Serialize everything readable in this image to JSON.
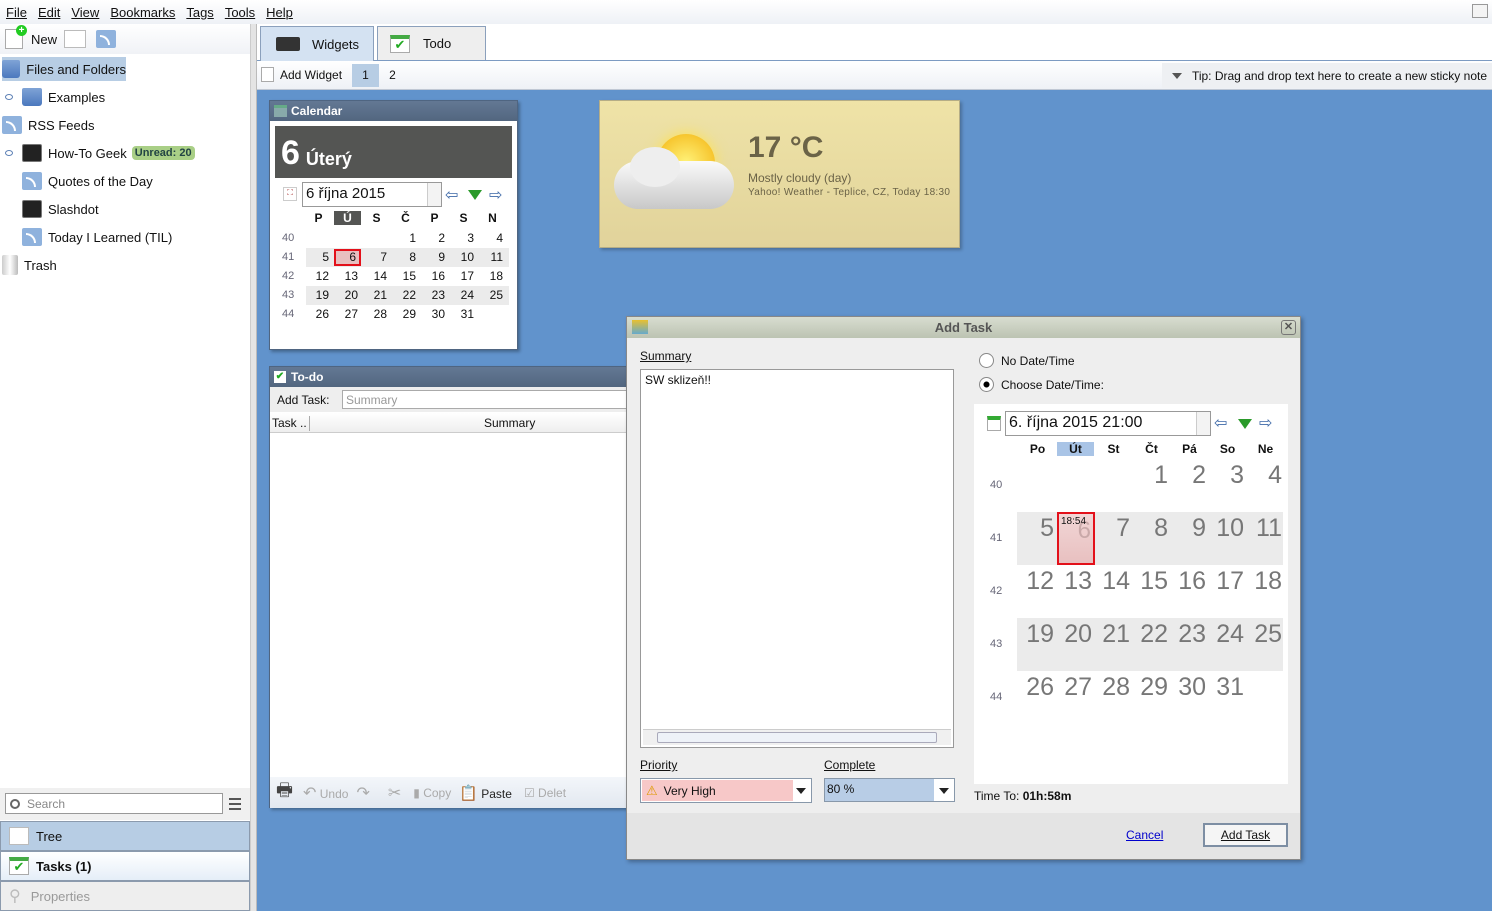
{
  "menu": [
    "File",
    "Edit",
    "View",
    "Bookmarks",
    "Tags",
    "Tools",
    "Help"
  ],
  "left_toolbar": {
    "new_label": "New"
  },
  "tree": [
    {
      "label": "Files and Folders",
      "icon": "folder-icon",
      "selected": true,
      "level": 0
    },
    {
      "label": "Examples",
      "icon": "folder-icon",
      "level": 1
    },
    {
      "label": "RSS Feeds",
      "icon": "rss-icon",
      "level": 0
    },
    {
      "label": "How-To Geek",
      "icon": "terminal-icon",
      "level": 1,
      "badge": "Unread: 20"
    },
    {
      "label": "Quotes of the Day",
      "icon": "rss-icon",
      "level": 1
    },
    {
      "label": "Slashdot",
      "icon": "terminal-icon",
      "level": 1
    },
    {
      "label": "Today I Learned (TIL)",
      "icon": "rss-icon",
      "level": 1
    },
    {
      "label": "Trash",
      "icon": "trash-icon",
      "level": 0
    }
  ],
  "search": {
    "placeholder": "Search"
  },
  "bottom_tabs": {
    "tree": "Tree",
    "tasks": "Tasks (1)",
    "properties": "Properties"
  },
  "tabs": {
    "widgets": "Widgets",
    "todo": "Todo"
  },
  "widget_toolbar": {
    "add_widget": "Add Widget",
    "pages": [
      "1",
      "2"
    ],
    "tip": "Tip: Drag and drop text here to create a new sticky note"
  },
  "calendar_widget": {
    "title": "Calendar",
    "day_number": "6",
    "day_name": "Úterý",
    "date_field": "6 října 2015",
    "weekdays": [
      "P",
      "Ú",
      "S",
      "Č",
      "P",
      "S",
      "N"
    ],
    "selected_weekday": 1,
    "weeks": [
      {
        "num": "40",
        "days": [
          "",
          "",
          "",
          "1",
          "2",
          "3",
          "4"
        ]
      },
      {
        "num": "41",
        "days": [
          "5",
          "6",
          "7",
          "8",
          "9",
          "10",
          "11"
        ]
      },
      {
        "num": "42",
        "days": [
          "12",
          "13",
          "14",
          "15",
          "16",
          "17",
          "18"
        ]
      },
      {
        "num": "43",
        "days": [
          "19",
          "20",
          "21",
          "22",
          "23",
          "24",
          "25"
        ]
      },
      {
        "num": "44",
        "days": [
          "26",
          "27",
          "28",
          "29",
          "30",
          "31",
          ""
        ]
      }
    ],
    "selected_day": "6"
  },
  "weather": {
    "temp": "17 °C",
    "condition": "Mostly cloudy (day)",
    "source": "Yahoo! Weather - Teplice, CZ, Today 18:30"
  },
  "todo_widget": {
    "title": "To-do",
    "add_task_label": "Add Task:",
    "summary_placeholder": "Summary",
    "col_task": "Task ..",
    "col_summary": "Summary",
    "toolbar": {
      "undo": "Undo",
      "copy": "Copy",
      "paste": "Paste",
      "delete": "Delet"
    }
  },
  "dialog": {
    "title": "Add Task",
    "summary_label": "Summary",
    "summary_value": "SW sklizeň!!",
    "no_date": "No Date/Time",
    "choose_date": "Choose Date/Time:",
    "date_value": "6. října 2015 21:00",
    "weekdays": [
      "Po",
      "Út",
      "St",
      "Čt",
      "Pá",
      "So",
      "Ne"
    ],
    "selected_weekday": 1,
    "selected_time": "18:54",
    "priority_label": "Priority",
    "priority_value": "Very High",
    "complete_label": "Complete",
    "complete_value": "80 %",
    "time_to_label": "Time To:",
    "time_to_value": "01h:58m",
    "cancel": "Cancel",
    "add_task": "Add Task"
  },
  "colors": {
    "desktop": "#6193cc",
    "priority_bg": "#f7c8c8",
    "complete_bg": "#b8cde6",
    "selected": "#e3101a"
  }
}
